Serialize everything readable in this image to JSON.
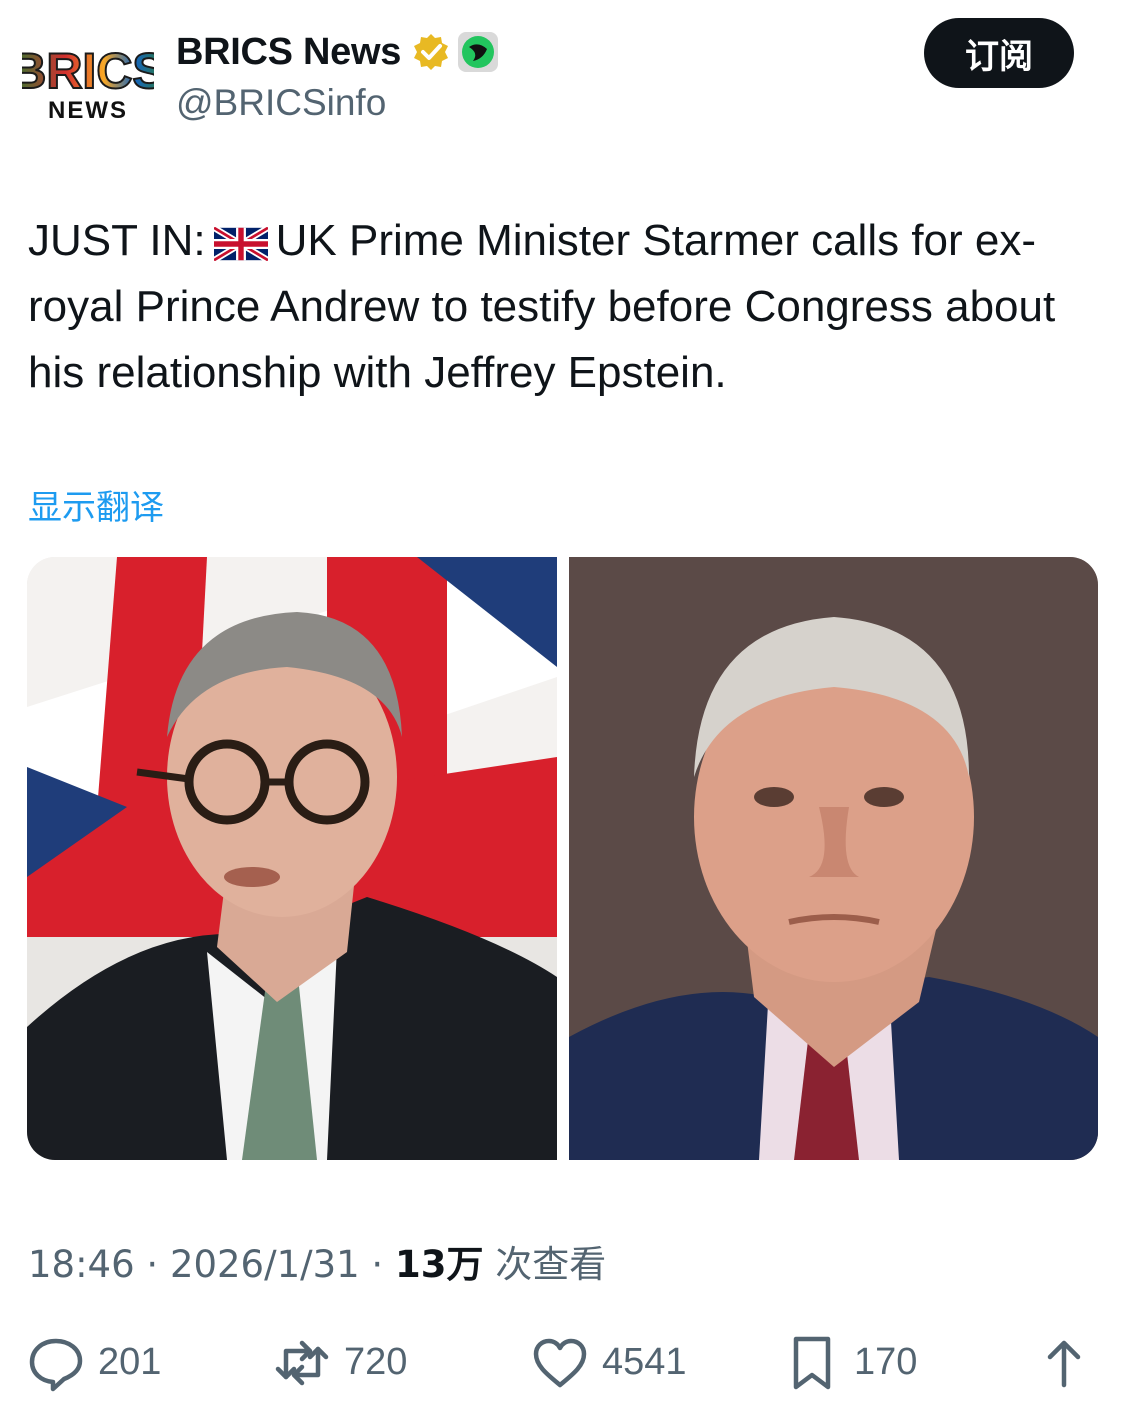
{
  "author": {
    "display_name": "BRICS News",
    "handle": "@BRICSinfo",
    "logo_text_top": "BRICS",
    "logo_text_bottom": "NEWS"
  },
  "subscribe_label": "订阅",
  "tweet": {
    "prefix": "JUST IN:",
    "flag_icon": "uk-flag-icon",
    "text": "UK Prime Minister Starmer calls for ex-royal Prince Andrew to testify before Congress about his relationship with Jeffrey Epstein."
  },
  "translate_label": "显示翻译",
  "meta": {
    "time": "18:46",
    "separator": "·",
    "date": "2026/1/31",
    "views_count": "13万",
    "views_label": "次查看"
  },
  "actions": {
    "replies": "201",
    "retweets": "720",
    "likes": "4541",
    "bookmarks": "170"
  },
  "colors": {
    "accent": "#1d9bf0",
    "text": "#0f1419",
    "muted": "#536471",
    "verified": "#e8b923"
  }
}
